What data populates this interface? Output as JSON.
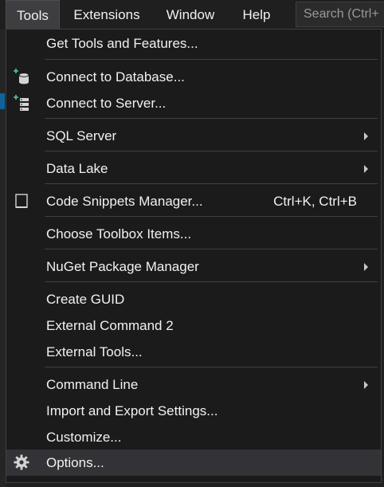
{
  "menubar": {
    "items": [
      {
        "label": "Tools"
      },
      {
        "label": "Extensions"
      },
      {
        "label": "Window"
      },
      {
        "label": "Help"
      }
    ],
    "search_placeholder": "Search (Ctrl+"
  },
  "menu": {
    "items": [
      {
        "label": "Get Tools and Features..."
      },
      {
        "label": "Connect to Database...",
        "icon": "database-connect-icon"
      },
      {
        "label": "Connect to Server...",
        "icon": "server-connect-icon"
      },
      {
        "label": "SQL Server",
        "submenu": true
      },
      {
        "label": "Data Lake",
        "submenu": true
      },
      {
        "label": "Code Snippets Manager...",
        "shortcut": "Ctrl+K, Ctrl+B",
        "icon": "snippet-icon"
      },
      {
        "label": "Choose Toolbox Items..."
      },
      {
        "label": "NuGet Package Manager",
        "submenu": true
      },
      {
        "label": "Create GUID"
      },
      {
        "label": "External Command 2"
      },
      {
        "label": "External Tools..."
      },
      {
        "label": "Command Line",
        "submenu": true
      },
      {
        "label": "Import and Export Settings..."
      },
      {
        "label": "Customize..."
      },
      {
        "label": "Options...",
        "icon": "gear-icon",
        "highlighted": true
      }
    ]
  },
  "colors": {
    "background": "#1f1f1f",
    "menu_background": "#1b1b1c",
    "highlight": "#333337",
    "separator": "#3f3f46",
    "text": "#f1f1f1",
    "accent_green": "#4ec9b0"
  }
}
